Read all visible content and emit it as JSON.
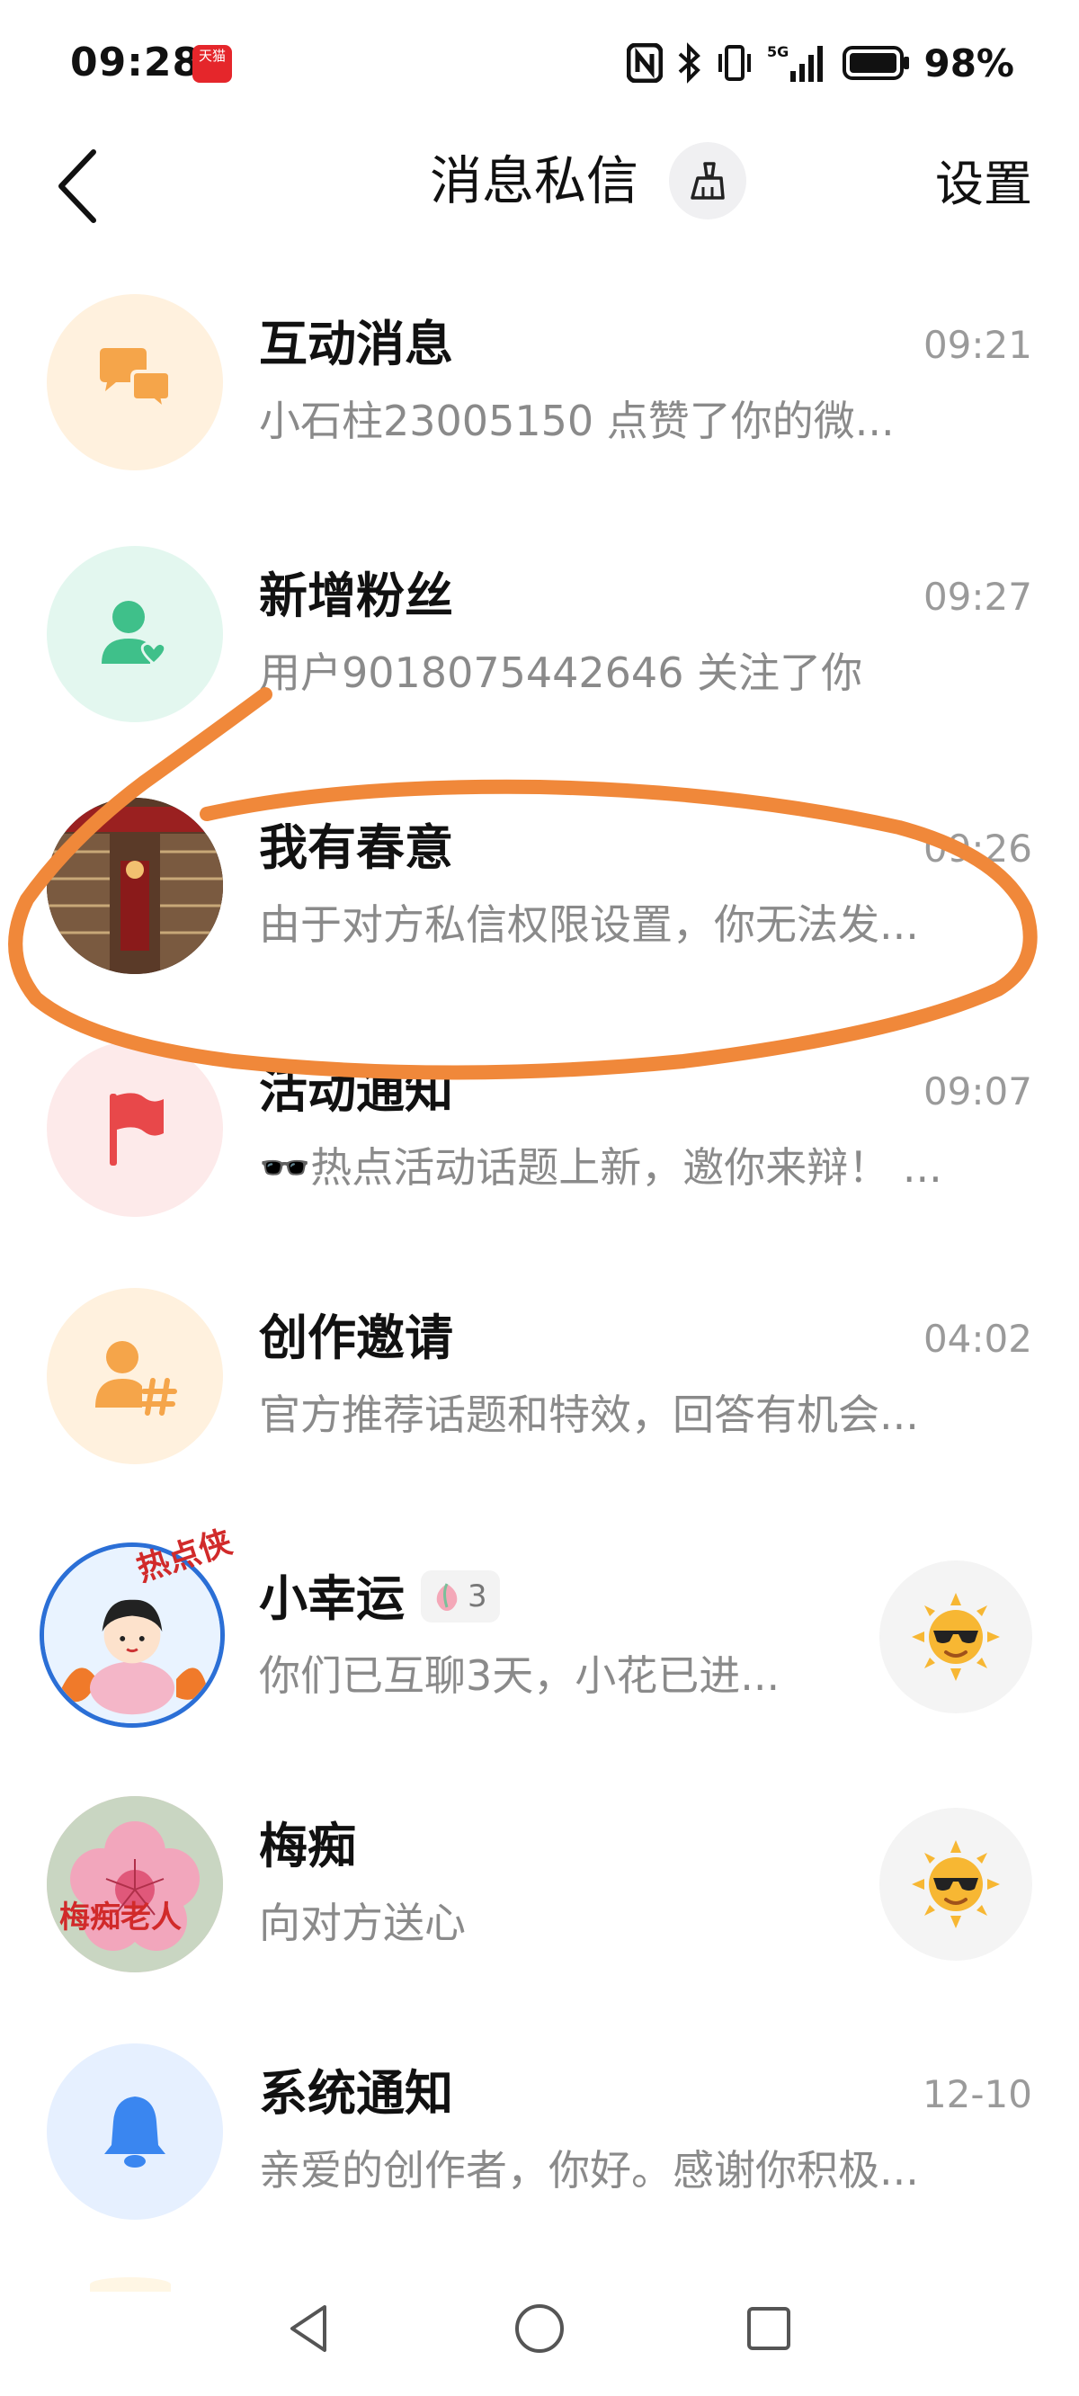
{
  "status_bar": {
    "time": "09:28",
    "app_badge": "天猫",
    "network": "5G",
    "battery": "98%"
  },
  "header": {
    "title": "消息私信",
    "settings": "设置"
  },
  "messages": [
    {
      "title": "互动消息",
      "preview": "小石柱23005150 点赞了你的微...",
      "time": "09:21",
      "icon": "chat-bubbles-icon",
      "color": "#f5a54a"
    },
    {
      "title": "新增粉丝",
      "preview": "用户9018075442646 关注了你",
      "time": "09:27",
      "icon": "user-heart-icon",
      "color": "#3fc08a"
    },
    {
      "title": "我有春意",
      "preview": "由于对方私信权限设置，你无法发...",
      "time": "09:26",
      "icon": "photo-avatar",
      "color": "#8a5a3a"
    },
    {
      "title": "活动通知",
      "preview": "🕶️热点活动话题上新，邀你来辩！ ...",
      "time": "09:07",
      "icon": "flag-icon",
      "color": "#e8484a"
    },
    {
      "title": "创作邀请",
      "preview": "官方推荐话题和特效，回答有机会...",
      "time": "04:02",
      "icon": "user-hashtag-icon",
      "color": "#f5a54a"
    },
    {
      "title": "小幸运",
      "preview": "你们已互聊3天，小花已进...",
      "badge": "3",
      "sticker_label": "热点侠",
      "icon": "cartoon-avatar",
      "side_icon": "sun-sunglasses-icon"
    },
    {
      "title": "梅痴",
      "preview": "向对方送心",
      "sticker_label": "梅痴老人",
      "icon": "plum-flower-avatar",
      "side_icon": "sun-sunglasses-icon"
    },
    {
      "title": "系统通知",
      "preview": "亲爱的创作者，你好。感谢你积极...",
      "time": "12-10",
      "icon": "bell-icon",
      "color": "#3a86f0"
    }
  ],
  "annotation": {
    "color": "#f0883a"
  }
}
